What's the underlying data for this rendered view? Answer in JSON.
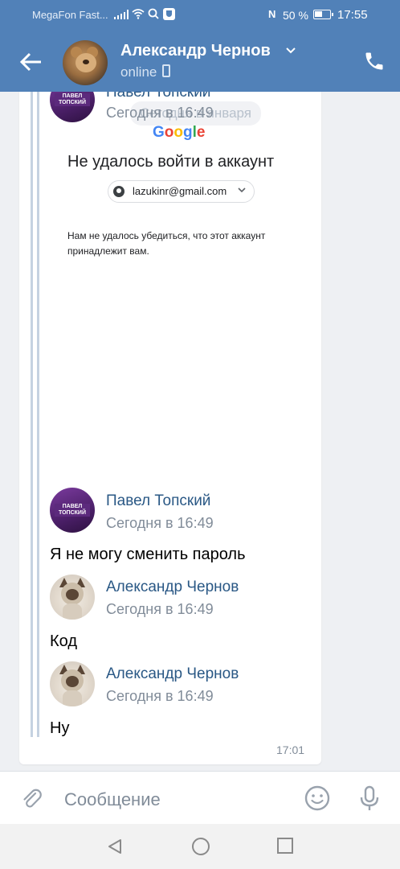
{
  "status_bar": {
    "carrier": "MegaFon Fast...",
    "nfc": "N",
    "battery": "50 %",
    "time": "17:55"
  },
  "header": {
    "contact_name": "Александр Чернов",
    "status": "online",
    "icons": [
      "back-arrow-icon",
      "chevron-down-icon",
      "mobile-phone-icon",
      "phone-call-icon"
    ]
  },
  "chat": {
    "date_pill": "Сегодня в января",
    "forwarded_screenshot": {
      "google_logo": {
        "g1": "G",
        "g2": "o",
        "g3": "o",
        "g4": "g",
        "g5": "l",
        "g6": "e"
      },
      "title": "Не удалось войти в аккаунт",
      "account_email": "lazukinr@gmail.com",
      "description": "Нам не удалось убедиться, что этот аккаунт принадлежит вам."
    },
    "messages": [
      {
        "sender": "Павел Топский",
        "time": "Сегодня в 16:49",
        "text": ""
      },
      {
        "sender": "Павел Топский",
        "time": "Сегодня в 16:49",
        "text": "Я не могу сменить пароль"
      },
      {
        "sender": "Александр Чернов",
        "time": "Сегодня в 16:49",
        "text": "Код"
      },
      {
        "sender": "Александр Чернов",
        "time": "Сегодня в 16:49",
        "text": "Ну"
      }
    ],
    "message_time": "17:01",
    "avatar_band_text": "ПАВЕЛ ТОПСКИЙ"
  },
  "input": {
    "placeholder": "Сообщение"
  },
  "colors": {
    "header": "#5181b8",
    "link": "#2a5885",
    "muted": "#818c99"
  }
}
